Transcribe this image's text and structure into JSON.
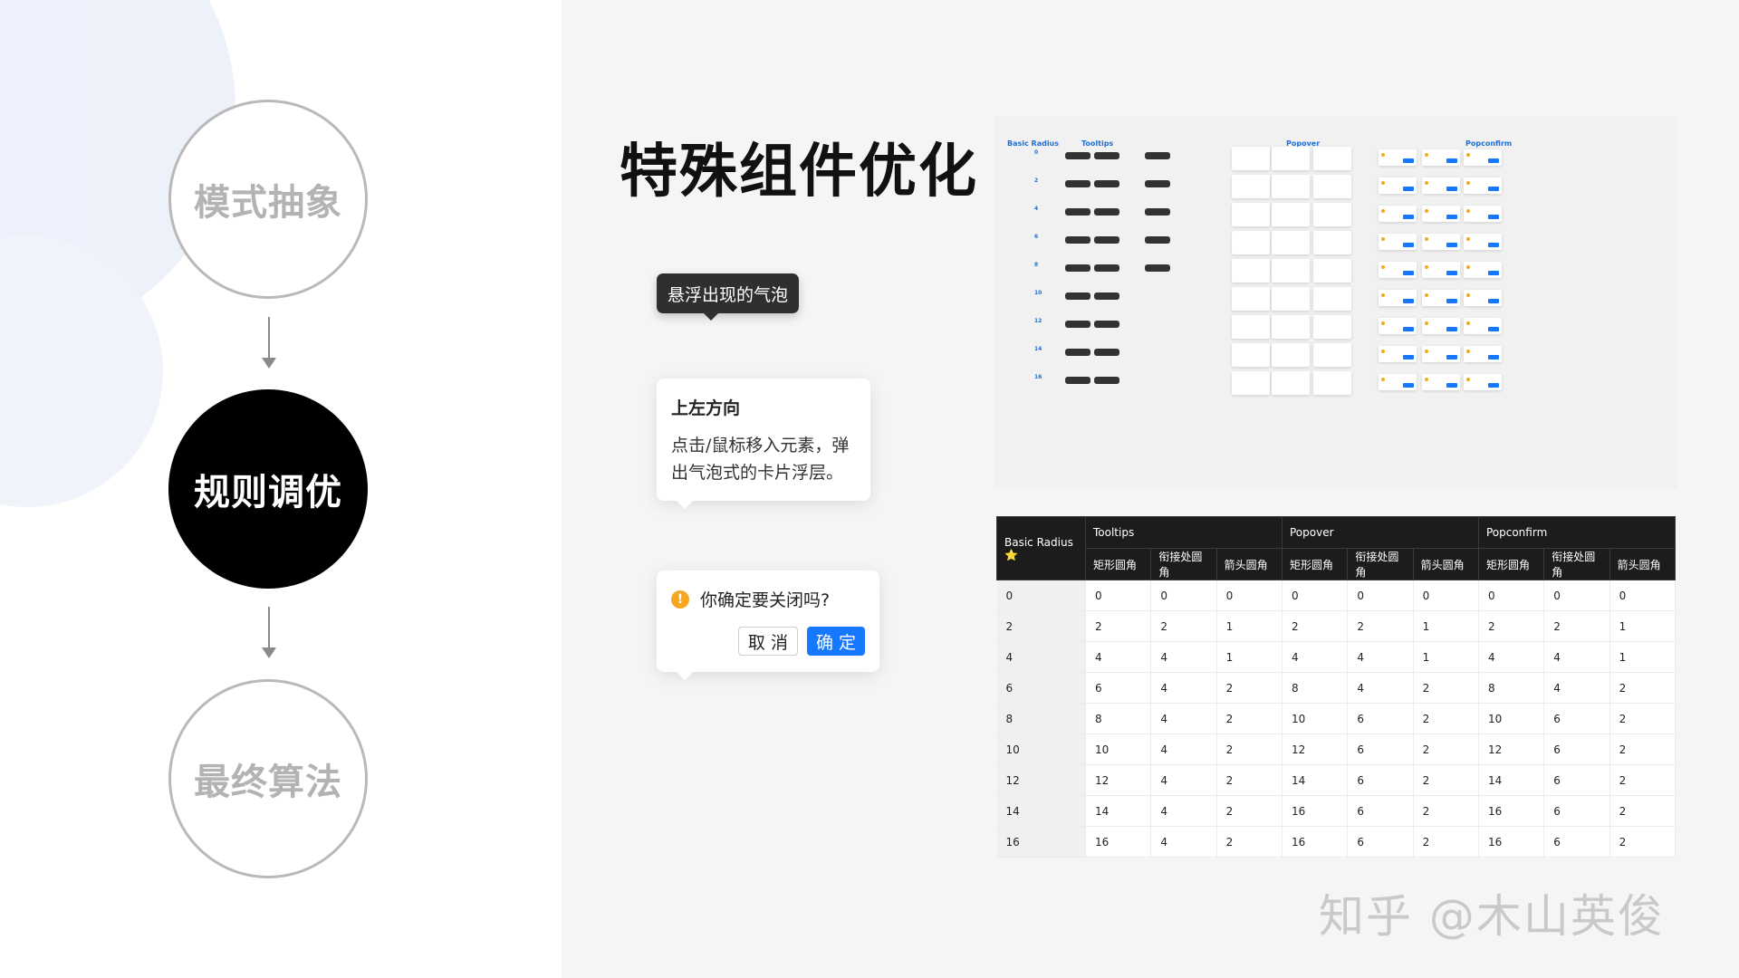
{
  "steps": [
    "模式抽象",
    "规则调优",
    "最终算法"
  ],
  "title": "特殊组件优化",
  "tooltip_demo": "悬浮出现的气泡",
  "popover_demo": {
    "title": "上左方向",
    "body": "点击/鼠标移入元素，弹出气泡式的卡片浮层。"
  },
  "popconfirm_demo": {
    "icon": "warning-icon",
    "icon_glyph": "!",
    "text": "你确定要关闭吗?",
    "cancel": "取 消",
    "ok": "确 定"
  },
  "board": {
    "labels": [
      "Basic Radius",
      "Tooltips",
      "Popover",
      "Popconfirm"
    ],
    "rows": [
      "0",
      "2",
      "4",
      "6",
      "8",
      "10",
      "12",
      "14",
      "16"
    ]
  },
  "table": {
    "corner": "Basic Radius ⭐",
    "groups": [
      "Tooltips",
      "Popover",
      "Popconfirm"
    ],
    "subheaders": [
      "矩形圆角",
      "衔接处圆角",
      "箭头圆角",
      "矩形圆角",
      "衔接处圆角",
      "箭头圆角",
      "矩形圆角",
      "衔接处圆角",
      "箭头圆角"
    ],
    "rows": [
      [
        "0",
        "0",
        "0",
        "0",
        "0",
        "0",
        "0",
        "0",
        "0",
        "0"
      ],
      [
        "2",
        "2",
        "2",
        "1",
        "2",
        "2",
        "1",
        "2",
        "2",
        "1"
      ],
      [
        "4",
        "4",
        "4",
        "1",
        "4",
        "4",
        "1",
        "4",
        "4",
        "1"
      ],
      [
        "6",
        "6",
        "4",
        "2",
        "8",
        "4",
        "2",
        "8",
        "4",
        "2"
      ],
      [
        "8",
        "8",
        "4",
        "2",
        "10",
        "6",
        "2",
        "10",
        "6",
        "2"
      ],
      [
        "10",
        "10",
        "4",
        "2",
        "12",
        "6",
        "2",
        "12",
        "6",
        "2"
      ],
      [
        "12",
        "12",
        "4",
        "2",
        "14",
        "6",
        "2",
        "14",
        "6",
        "2"
      ],
      [
        "14",
        "14",
        "4",
        "2",
        "16",
        "6",
        "2",
        "16",
        "6",
        "2"
      ],
      [
        "16",
        "16",
        "4",
        "2",
        "16",
        "6",
        "2",
        "16",
        "6",
        "2"
      ]
    ]
  },
  "watermark": "知乎 @木山英俊",
  "colors": {
    "primary": "#1677ff",
    "warning": "#f5a623",
    "dark": "#1c1c1c"
  }
}
